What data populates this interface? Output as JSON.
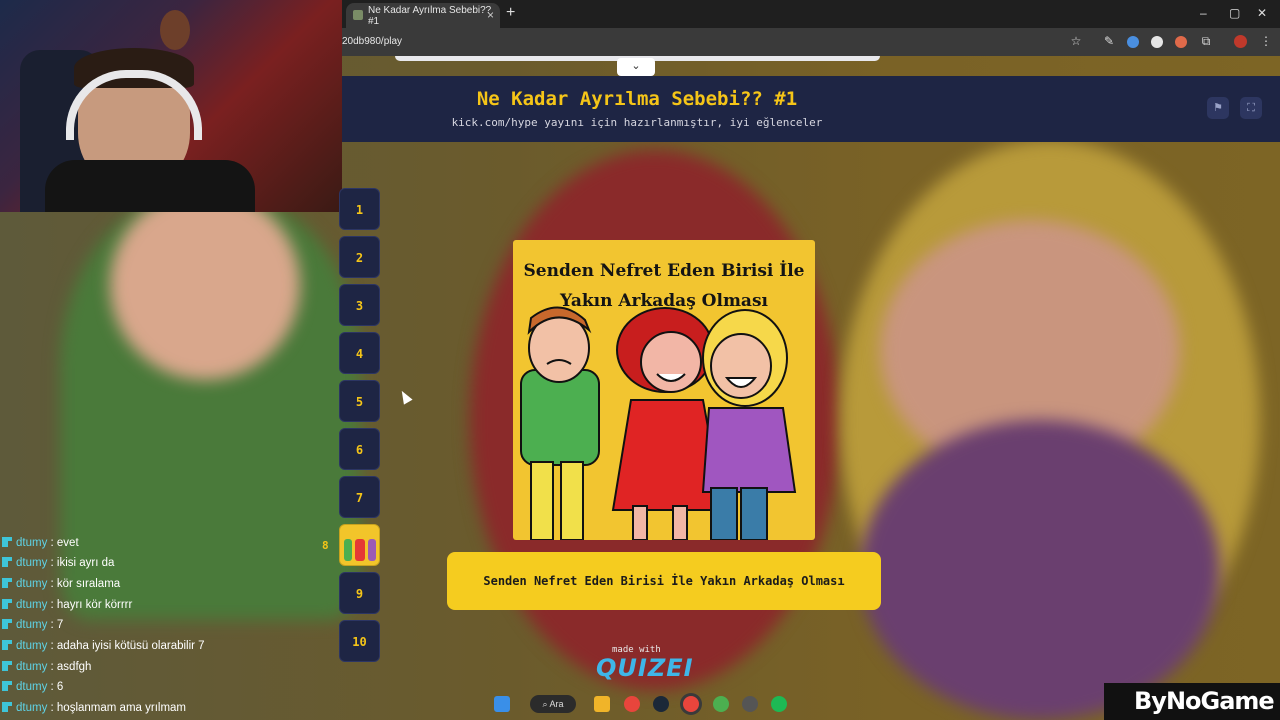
{
  "browser": {
    "tab_title": "Ne Kadar Ayrılma Sebebi?? #1",
    "tab_close": "×",
    "new_tab": "+",
    "url": "20db980/play",
    "window_controls": [
      "–",
      "▢",
      "✕"
    ]
  },
  "quiz": {
    "title": "Ne Kadar Ayrılma Sebebi?? #1",
    "subtitle": "kick.com/hype yayını için hazırlanmıştır, iyi eğlenceler",
    "questions": [
      "1",
      "2",
      "3",
      "4",
      "5",
      "6",
      "7",
      "8",
      "9",
      "10"
    ],
    "current_index_label": "8",
    "card_title": "Senden Nefret Eden Birisi İle Yakın Arkadaş Olması",
    "answer_text": "Senden Nefret Eden Birisi İle Yakın Arkadaş Olması",
    "made_with": "made with",
    "brand": "QUIZEI"
  },
  "chat": {
    "messages": [
      {
        "user": "dtumy",
        "text": " : evet"
      },
      {
        "user": "dtumy",
        "text": " : ikisi ayrı da"
      },
      {
        "user": "dtumy",
        "text": " : kör sıralama"
      },
      {
        "user": "dtumy",
        "text": " : hayrı kör körrrr"
      },
      {
        "user": "dtumy",
        "text": " : 7"
      },
      {
        "user": "dtumy",
        "text": " : adaha iyisi kötüsü olarabilir 7"
      },
      {
        "user": "dtumy",
        "text": " : asdfgh"
      },
      {
        "user": "dtumy",
        "text": " : 6"
      },
      {
        "user": "dtumy",
        "text": " : hoşlanmam ama yrılmam"
      }
    ]
  },
  "taskbar": {
    "search_label": "Ara"
  },
  "overlay_logo": "ByNoGame",
  "colors": {
    "accent_yellow": "#f5c518",
    "header_navy": "#1e2544",
    "chat_user": "#5fd3e6"
  }
}
